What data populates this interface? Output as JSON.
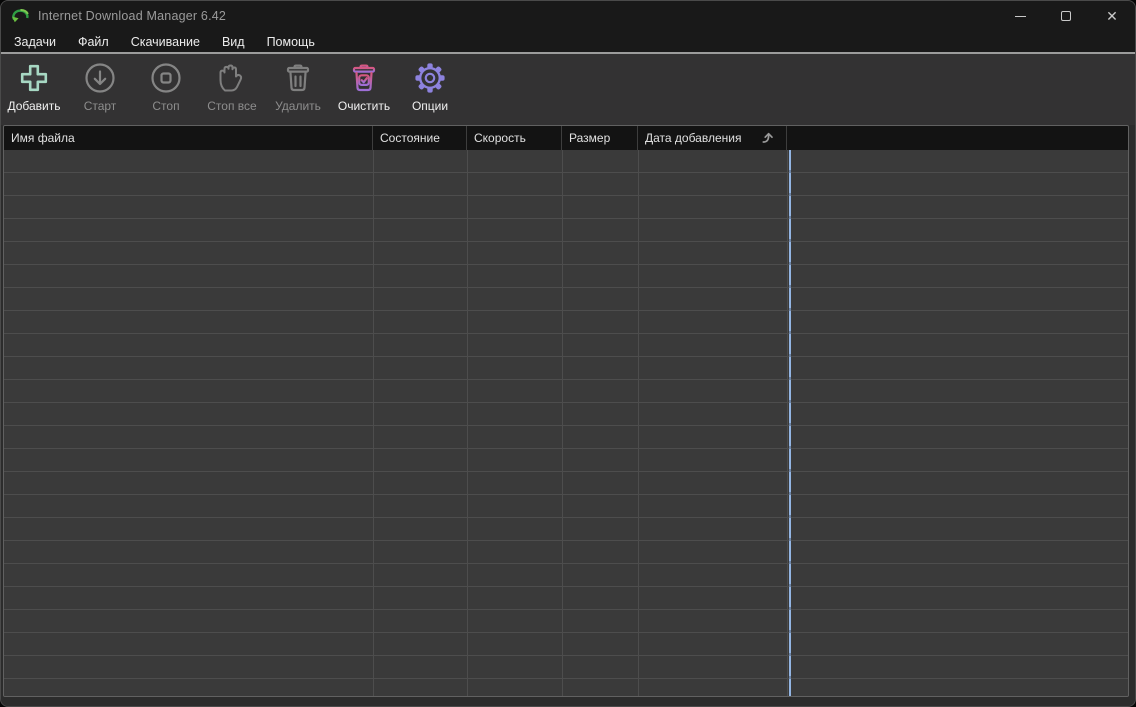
{
  "window": {
    "title": "Internet Download Manager 6.42",
    "controls": {
      "minimize": "minimize",
      "maximize": "maximize",
      "close": "✕"
    }
  },
  "menu": {
    "items": [
      "Задачи",
      "Файл",
      "Скачивание",
      "Вид",
      "Помощь"
    ]
  },
  "toolbar": {
    "buttons": [
      {
        "label": "Добавить",
        "icon": "add-plus-icon",
        "enabled": true
      },
      {
        "label": "Старт",
        "icon": "start-download-icon",
        "enabled": false
      },
      {
        "label": "Стоп",
        "icon": "stop-icon",
        "enabled": false
      },
      {
        "label": "Стоп все",
        "icon": "stop-all-hand-icon",
        "enabled": false
      },
      {
        "label": "Удалить",
        "icon": "delete-trash-icon",
        "enabled": false
      },
      {
        "label": "Очистить",
        "icon": "clear-trash-check-icon",
        "enabled": true
      },
      {
        "label": "Опции",
        "icon": "options-gear-icon",
        "enabled": true
      }
    ]
  },
  "table": {
    "columns": [
      {
        "label": "Имя файла"
      },
      {
        "label": "Состояние"
      },
      {
        "label": "Скорость"
      },
      {
        "label": "Размер"
      },
      {
        "label": "Дата добавления",
        "sort_icon": "sort-ascending-icon"
      }
    ],
    "rows": []
  },
  "colors": {
    "accent_add": "#a7d8c3",
    "accent_clear_top": "#d6577f",
    "accent_clear_bottom": "#9e6fd6",
    "accent_options": "#8d82de",
    "disabled_gray": "#858585",
    "column_marker_blue": "#93b5e3",
    "header_bg": "#131313",
    "table_bg": "#3a3a3a"
  }
}
